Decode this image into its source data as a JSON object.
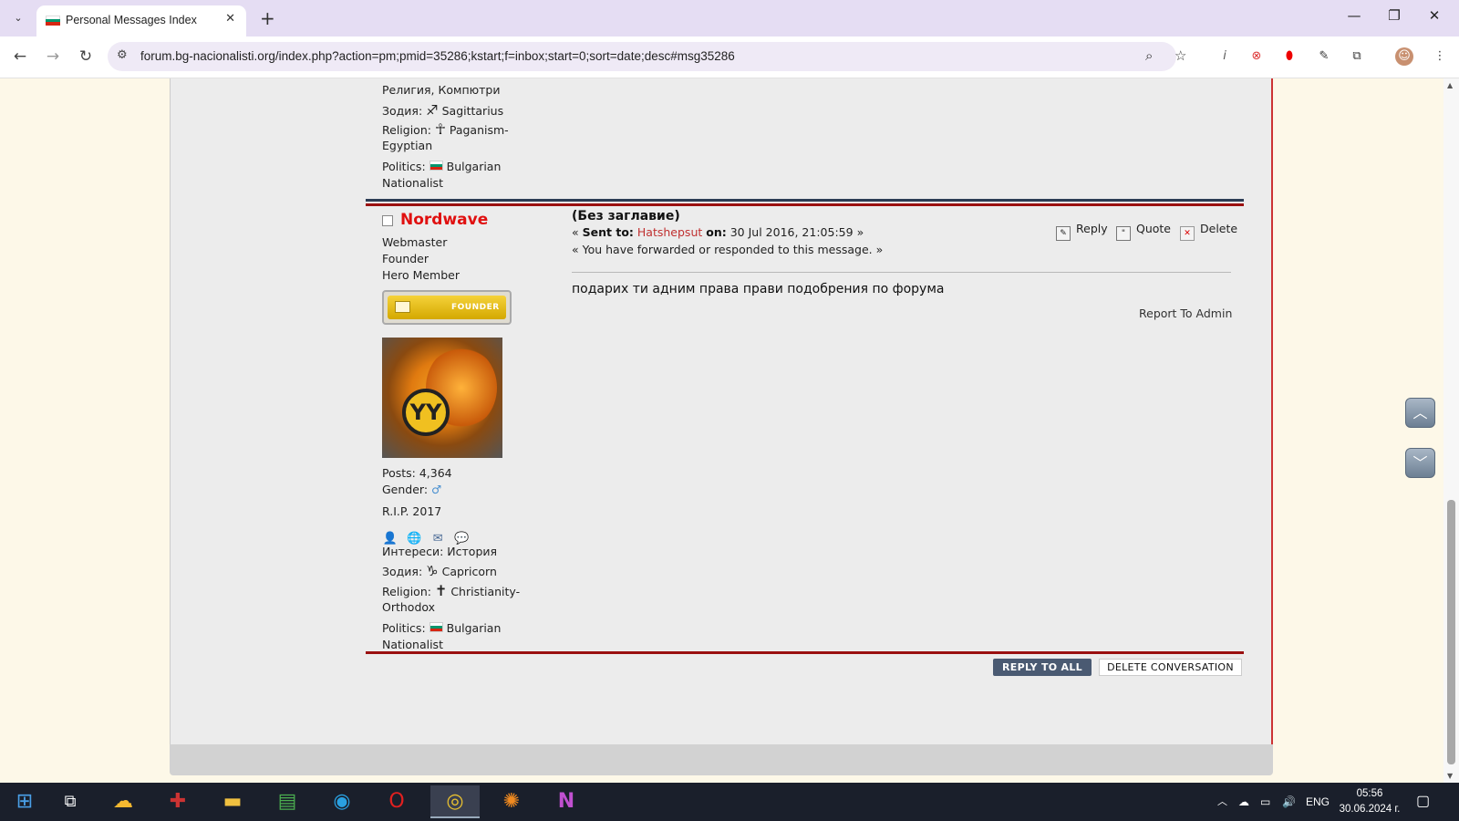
{
  "browser": {
    "tab_title": "Personal Messages Index",
    "tab_list_icon": "chevron-down-icon",
    "new_tab_label": "+",
    "url": "forum.bg-nacionalisti.org/index.php?action=pm;pmid=35286;kstart;f=inbox;start=0;sort=date;desc#msg35286",
    "flag_colors": [
      "#ffffff",
      "#00966e",
      "#d62612"
    ]
  },
  "previous_post": {
    "interests_tail": "Религия, Компютри",
    "zodiac_label": "Зодия:",
    "zodiac_value": "Sagittarius",
    "zodiac_symbol": "♐",
    "religion_label": "Religion:",
    "religion_value_1": "Paganism-",
    "religion_value_2": "Egyptian",
    "religion_symbol": "☥",
    "politics_label": "Politics:",
    "politics_value_1": "Bulgarian",
    "politics_value_2": "Nationalist"
  },
  "post": {
    "poster_name": "Nordwave",
    "titles": [
      "Webmaster",
      "Founder",
      "Hero Member"
    ],
    "badge_label": "FOUNDER",
    "avatar_emblem": "YY",
    "posts_label": "Posts: 4,364",
    "gender_label": "Gender:",
    "gender_symbol": "♂",
    "rip": "R.I.P. 2017",
    "profile_icons": [
      "profile-icon",
      "website-icon",
      "email-icon",
      "pm-icon"
    ],
    "interests": "Интереси: История",
    "zodiac_label": "Зодия:",
    "zodiac_value": "Capricorn",
    "zodiac_symbol": "♑",
    "religion_label": "Religion:",
    "religion_value_1": "Christianity-",
    "religion_value_2": "Orthodox",
    "religion_symbol": "✝",
    "politics_label": "Politics:",
    "politics_value_1": "Bulgarian",
    "politics_value_2": "Nationalist",
    "subject": "(Без заглавие)",
    "sent_prefix": "«",
    "sent_to_label": "Sent to:",
    "sent_to_user": "Hatshepsut",
    "on_label": "on:",
    "date": "30 Jul 2016, 21:05:59",
    "sent_suffix": "»",
    "forwarded_note": "« You have forwarded or responded to this message. »",
    "body": "подарих ти адним права прави подобрения по форума",
    "report": "Report To Admin",
    "actions": {
      "reply": "Reply",
      "quote": "Quote",
      "delete": "Delete"
    }
  },
  "bottom_buttons": {
    "reply_all": "REPLY TO ALL",
    "delete_conversation": "DELETE CONVERSATION"
  },
  "taskbar": {
    "language": "ENG",
    "time": "05:56",
    "date": "30.06.2024 г."
  },
  "colors": {
    "poster_name": "#e01010",
    "accent_red": "#9a1010",
    "accent_navy": "#2d3d55"
  }
}
